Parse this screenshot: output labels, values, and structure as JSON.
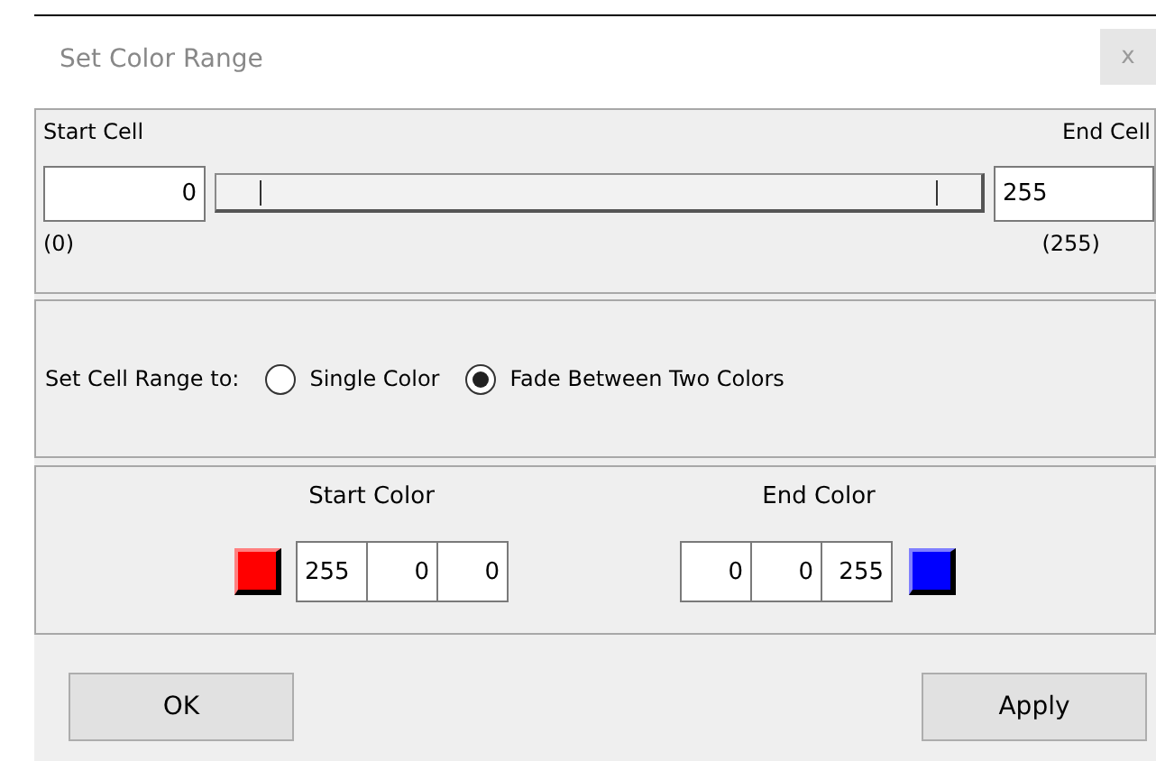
{
  "window": {
    "title": "Set Color Range",
    "close": "x"
  },
  "cell_range": {
    "start_label": "Start Cell",
    "end_label": "End Cell",
    "start_value": "0",
    "end_value": "255",
    "thumbs": [
      {
        "level": 0
      },
      {
        "level": 1
      }
    ],
    "start_min": "(0)",
    "end_max": "(255)"
  },
  "mode": {
    "label": "Set Cell Range to:",
    "options": [
      {
        "label": "Single Color",
        "selected": false
      },
      {
        "label": "Fade Between Two Colors",
        "selected": true
      }
    ]
  },
  "colors": [
    {
      "heading": "Start Color",
      "color": "#ff0000",
      "values": [
        "255",
        "0",
        "0"
      ]
    },
    {
      "heading": "End Color",
      "color": "#0000ff",
      "values": [
        "0",
        "0",
        "255"
      ]
    }
  ],
  "buttons": [
    "OK",
    "Apply"
  ]
}
